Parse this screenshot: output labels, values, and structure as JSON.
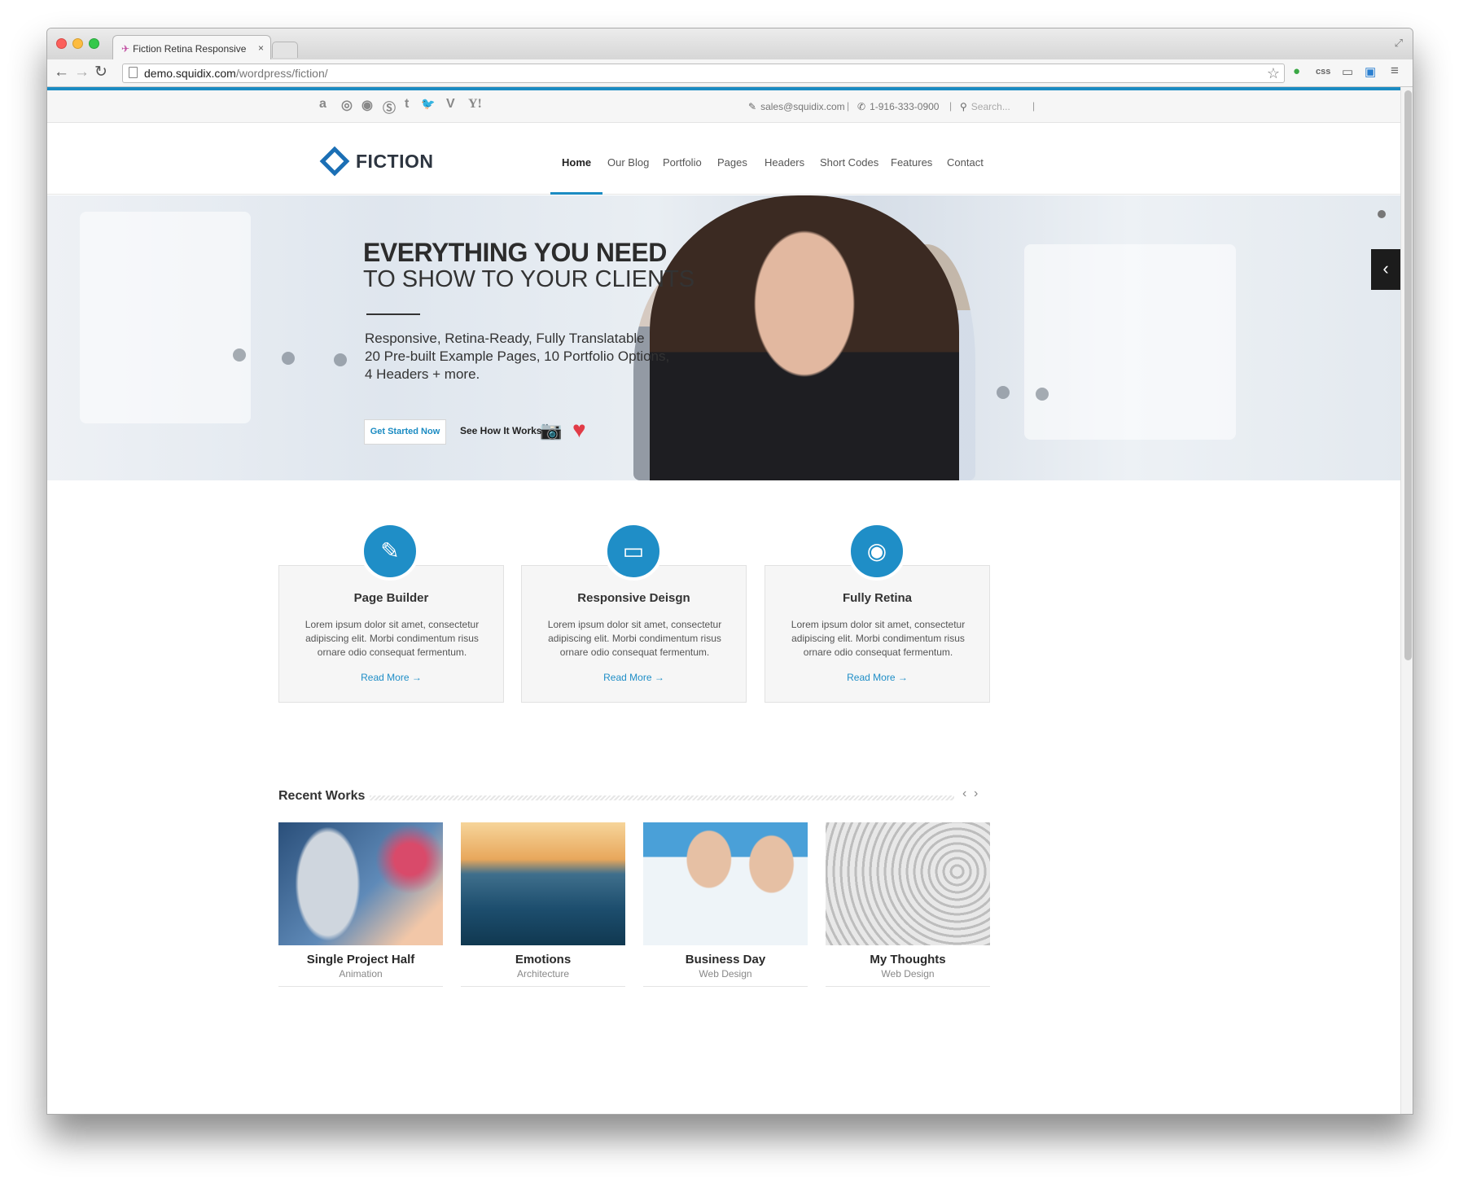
{
  "browser": {
    "tab_title": "Fiction Retina Responsive",
    "tab_close": "×",
    "url_host": "demo.squidix.com",
    "url_path": "/wordpress/fiction/",
    "ext_css": "css"
  },
  "topbar": {
    "social": [
      "a",
      "◎",
      "◉",
      "Ⓢ",
      "t",
      "🐦",
      "V",
      "Y!"
    ],
    "social_names": [
      "amazon-icon",
      "dribbble-icon",
      "picasa-icon",
      "skype-icon",
      "tumblr-icon",
      "twitter-icon",
      "vimeo-icon",
      "yahoo-icon"
    ],
    "email": "sales@squidix.com",
    "phone": "1-916-333-0900",
    "search_placeholder": "Search...",
    "sep": "|"
  },
  "header": {
    "logo_text": "FICTION",
    "nav": [
      "Home",
      "Our Blog",
      "Portfolio",
      "Pages",
      "Headers",
      "Short Codes",
      "Features",
      "Contact"
    ],
    "active_index": 0
  },
  "hero": {
    "headline": "EVERYTHING YOU NEED",
    "subheadline": "TO SHOW TO YOUR CLIENTS",
    "line1": "Responsive, Retina-Ready, Fully Translatable",
    "line2": "20 Pre-built Example Pages, 10 Portfolio Options,",
    "line3": "4 Headers + more.",
    "cta": "Get Started Now",
    "how": "See How It Works"
  },
  "features": [
    {
      "icon": "✎",
      "icon_name": "pencil-icon",
      "title": "Page Builder",
      "text": "Lorem ipsum dolor sit amet, consectetur adipiscing elit. Morbi condimentum risus ornare odio consequat fermentum.",
      "link": "Read More →"
    },
    {
      "icon": "▭",
      "icon_name": "laptop-icon",
      "title": "Responsive Deisgn",
      "text": "Lorem ipsum dolor sit amet, consectetur adipiscing elit. Morbi condimentum risus ornare odio consequat fermentum.",
      "link": "Read More →"
    },
    {
      "icon": "◉",
      "icon_name": "eye-icon",
      "title": "Fully Retina",
      "text": "Lorem ipsum dolor sit amet, consectetur adipiscing elit. Morbi condimentum risus ornare odio consequat fermentum.",
      "link": "Read More →"
    }
  ],
  "recent": {
    "title": "Recent Works",
    "prev": "‹",
    "next": "›",
    "items": [
      {
        "title": "Single Project Half",
        "category": "Animation"
      },
      {
        "title": "Emotions",
        "category": "Architecture"
      },
      {
        "title": "Business Day",
        "category": "Web Design"
      },
      {
        "title": "My Thoughts",
        "category": "Web Design"
      }
    ]
  },
  "colors": {
    "accent": "#1b8bc2",
    "logo": "#1b6fb5",
    "heart": "#e13b47"
  }
}
